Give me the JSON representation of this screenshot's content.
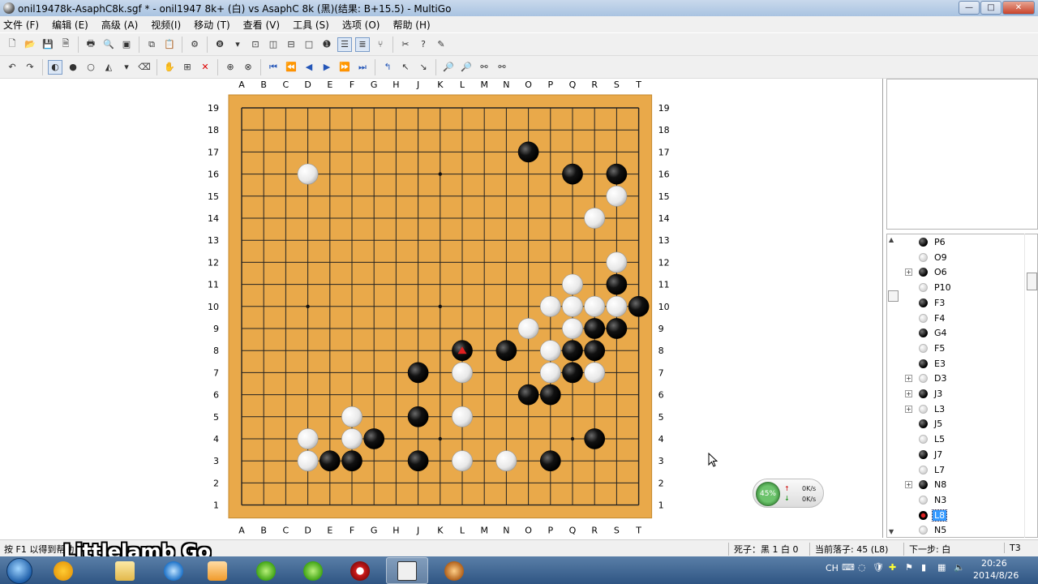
{
  "window": {
    "title": "onil19478k-AsaphC8k.sgf  * - onil1947 8k+ (白) vs AsaphC 8k (黑)(结果: B+15.5) - MultiGo",
    "controls": [
      "—",
      "□",
      "✕"
    ]
  },
  "menu": [
    "文件 (F)",
    "编辑 (E)",
    "高级 (A)",
    "视频(I)",
    "移动 (T)",
    "查看 (V)",
    "工具 (S)",
    "选项 (O)",
    "帮助 (H)"
  ],
  "board": {
    "columns": [
      "A",
      "B",
      "C",
      "D",
      "E",
      "F",
      "G",
      "H",
      "J",
      "K",
      "L",
      "M",
      "N",
      "O",
      "P",
      "Q",
      "R",
      "S",
      "T"
    ],
    "rows": [
      "19",
      "18",
      "17",
      "16",
      "15",
      "14",
      "13",
      "12",
      "11",
      "10",
      "9",
      "8",
      "7",
      "6",
      "5",
      "4",
      "3",
      "2",
      "1"
    ],
    "hoshi": [
      "D4",
      "K4",
      "Q4",
      "D10",
      "K10",
      "Q10",
      "D16",
      "K16",
      "Q16"
    ],
    "black": [
      "O17",
      "Q16",
      "S16",
      "S11",
      "T10",
      "R9",
      "S9",
      "L8",
      "N8",
      "Q8",
      "R8",
      "J7",
      "Q7",
      "O6",
      "P6",
      "J5",
      "G4",
      "R4",
      "E3",
      "F3",
      "J3",
      "P3"
    ],
    "white": [
      "D16",
      "S15",
      "R14",
      "S12",
      "Q11",
      "P10",
      "Q10",
      "R10",
      "S10",
      "O9",
      "Q9",
      "P8",
      "L7",
      "P7",
      "R7",
      "F5",
      "L5",
      "D4",
      "F4",
      "D3",
      "L3",
      "N3"
    ],
    "last_move": "L8"
  },
  "moves": [
    {
      "color": "b",
      "label": "P6",
      "expand": false
    },
    {
      "color": "w",
      "label": "O9",
      "expand": false
    },
    {
      "color": "b",
      "label": "O6",
      "expand": true
    },
    {
      "color": "w",
      "label": "P10",
      "expand": false
    },
    {
      "color": "b",
      "label": "F3",
      "expand": false
    },
    {
      "color": "w",
      "label": "F4",
      "expand": false
    },
    {
      "color": "b",
      "label": "G4",
      "expand": false
    },
    {
      "color": "w",
      "label": "F5",
      "expand": false
    },
    {
      "color": "b",
      "label": "E3",
      "expand": false
    },
    {
      "color": "w",
      "label": "D3",
      "expand": true
    },
    {
      "color": "b",
      "label": "J3",
      "expand": true
    },
    {
      "color": "w",
      "label": "L3",
      "expand": true
    },
    {
      "color": "b",
      "label": "J5",
      "expand": false
    },
    {
      "color": "w",
      "label": "L5",
      "expand": false
    },
    {
      "color": "b",
      "label": "J7",
      "expand": false
    },
    {
      "color": "w",
      "label": "L7",
      "expand": false
    },
    {
      "color": "b",
      "label": "N8",
      "expand": true
    },
    {
      "color": "w",
      "label": "N3",
      "expand": false
    },
    {
      "color": "cur",
      "label": "L8",
      "expand": false,
      "selected": true
    },
    {
      "color": "w",
      "label": "N5",
      "expand": false
    }
  ],
  "status": {
    "help": "按 F1 以得到帮助",
    "dead": "死子：黑 1 白 0",
    "current": "当前落子: 45 (L8)",
    "next": "下一步: 白",
    "mode": "T3"
  },
  "watermark": "Littlelamb Go",
  "netmonitor": {
    "percent": "45%",
    "up": "0K/s",
    "down": "0K/s"
  },
  "taskbar": {
    "lang": "CH",
    "time": "20:26",
    "date": "2014/8/26"
  }
}
